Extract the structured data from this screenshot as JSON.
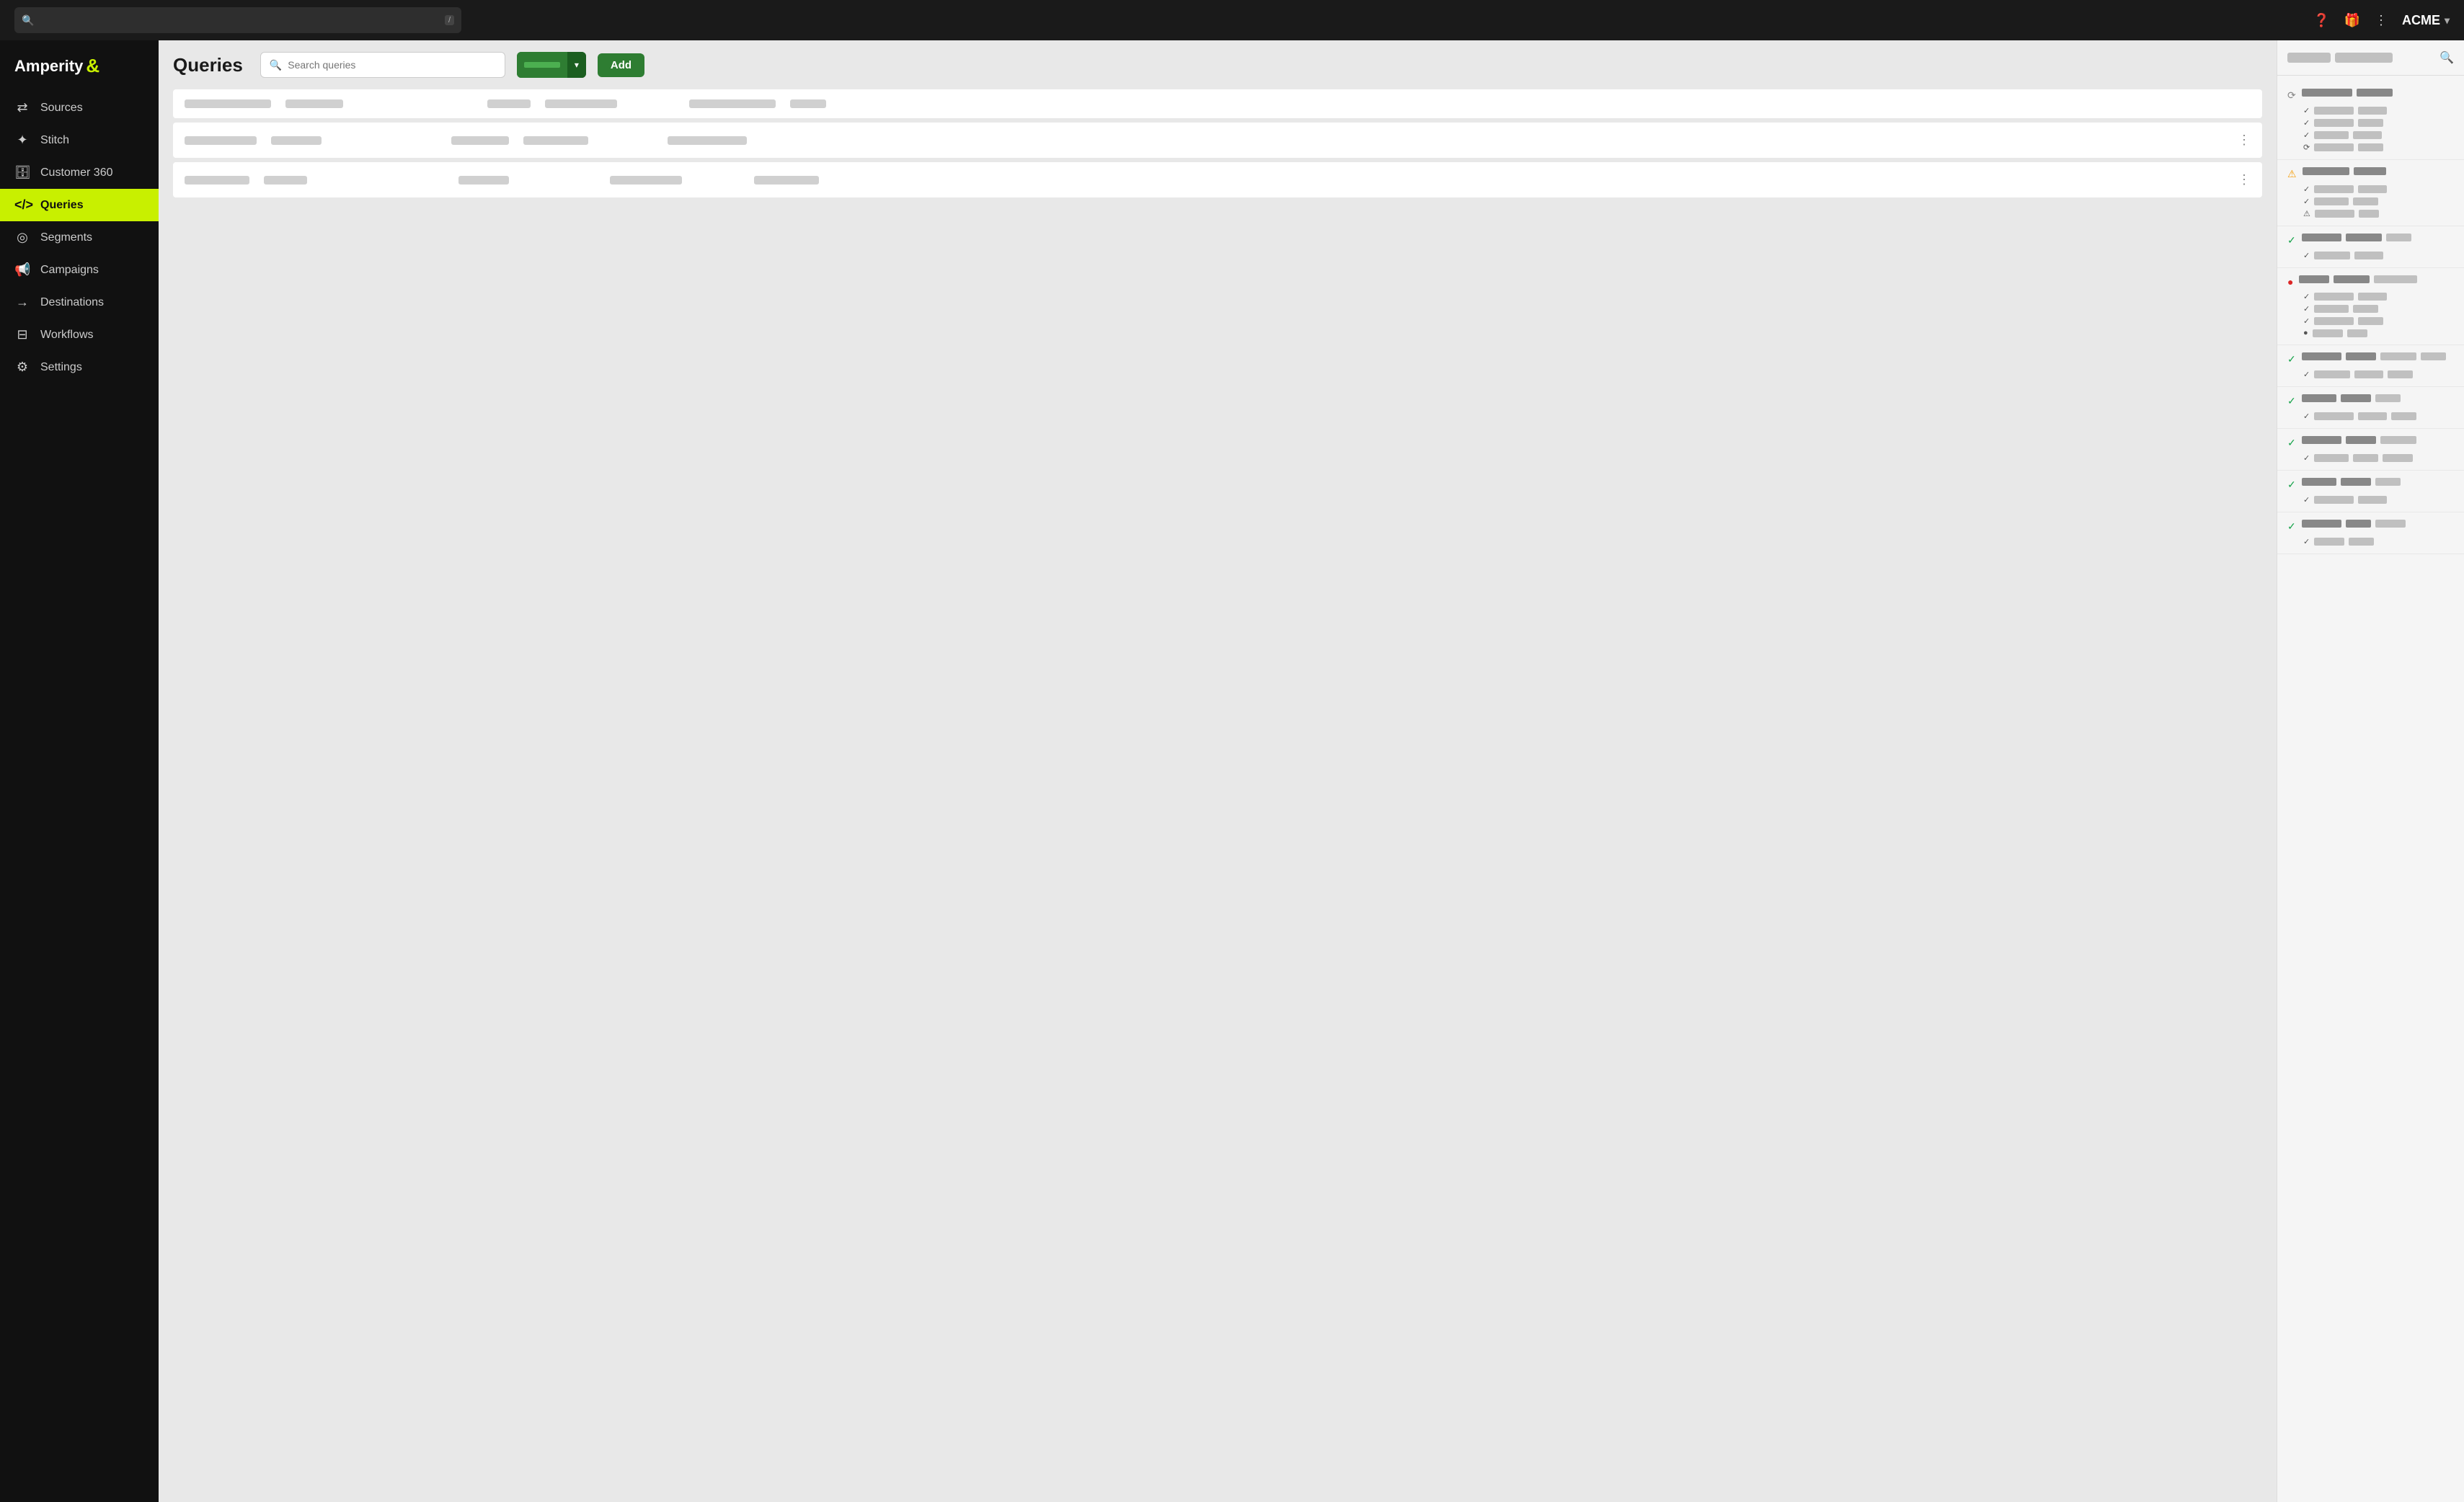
{
  "app": {
    "name": "Amperity",
    "account": "ACME"
  },
  "topbar": {
    "search_placeholder": "/",
    "help_icon": "?",
    "gift_icon": "🎁",
    "more_icon": "⋮",
    "chevron": "▾"
  },
  "sidebar": {
    "items": [
      {
        "id": "sources",
        "label": "Sources",
        "icon": "⇄",
        "active": false
      },
      {
        "id": "stitch",
        "label": "Stitch",
        "icon": "✦",
        "active": false
      },
      {
        "id": "customer360",
        "label": "Customer 360",
        "icon": "🗄",
        "active": false
      },
      {
        "id": "queries",
        "label": "Queries",
        "icon": "</>",
        "active": true
      },
      {
        "id": "segments",
        "label": "Segments",
        "icon": "◎",
        "active": false
      },
      {
        "id": "campaigns",
        "label": "Campaigns",
        "icon": "📢",
        "active": false
      },
      {
        "id": "destinations",
        "label": "Destinations",
        "icon": "→",
        "active": false
      },
      {
        "id": "workflows",
        "label": "Workflows",
        "icon": "⊟",
        "active": false
      },
      {
        "id": "settings",
        "label": "Settings",
        "icon": "⚙",
        "active": false
      }
    ]
  },
  "queries": {
    "title": "Queries",
    "search_placeholder": "Search queries",
    "add_label": "Add",
    "table_rows": [
      {
        "id": 1
      },
      {
        "id": 2
      },
      {
        "id": 3
      }
    ]
  },
  "right_panel": {
    "header_label1": "████████",
    "header_label2": "██████████",
    "items": [
      {
        "id": 1,
        "status": "loading",
        "title_parts": [
          18,
          12
        ],
        "rows": [
          {
            "icon": "check",
            "parts": [
              14,
              10
            ]
          },
          {
            "icon": "check",
            "parts": [
              14,
              8
            ]
          },
          {
            "icon": "check",
            "parts": [
              12,
              10
            ]
          },
          {
            "icon": "loading",
            "parts": [
              14,
              8
            ]
          }
        ]
      },
      {
        "id": 2,
        "status": "warning",
        "title_parts": [
          16,
          10
        ],
        "rows": [
          {
            "icon": "check",
            "parts": [
              14,
              10
            ]
          },
          {
            "icon": "check",
            "parts": [
              12,
              8
            ]
          },
          {
            "icon": "warning",
            "parts": [
              14,
              6
            ]
          }
        ]
      },
      {
        "id": 3,
        "status": "success",
        "title_parts": [
          14,
          12,
          8
        ],
        "rows": [
          {
            "icon": "check",
            "parts": [
              12,
              10
            ]
          }
        ]
      },
      {
        "id": 4,
        "status": "error",
        "title_parts": [
          10,
          12,
          14
        ],
        "rows": [
          {
            "icon": "check",
            "parts": [
              14,
              10
            ]
          },
          {
            "icon": "check",
            "parts": [
              12,
              8
            ]
          },
          {
            "icon": "check",
            "parts": [
              14,
              8
            ]
          },
          {
            "icon": "error",
            "parts": [
              10,
              6
            ]
          }
        ]
      },
      {
        "id": 5,
        "status": "success",
        "title_parts": [
          14,
          10,
          12,
          8
        ],
        "rows": [
          {
            "icon": "check",
            "parts": [
              12,
              10,
              8
            ]
          }
        ]
      },
      {
        "id": 6,
        "status": "success",
        "title_parts": [
          12,
          10,
          8
        ],
        "rows": [
          {
            "icon": "check",
            "parts": [
              14,
              10,
              8
            ]
          }
        ]
      },
      {
        "id": 7,
        "status": "success",
        "title_parts": [
          14,
          10,
          12
        ],
        "rows": [
          {
            "icon": "check",
            "parts": [
              12,
              8,
              10
            ]
          }
        ]
      },
      {
        "id": 8,
        "status": "success",
        "title_parts": [
          12,
          10,
          8
        ],
        "rows": [
          {
            "icon": "check",
            "parts": [
              14,
              10
            ]
          }
        ]
      },
      {
        "id": 9,
        "status": "success",
        "title_parts": [
          14,
          8,
          10
        ],
        "rows": [
          {
            "icon": "check",
            "parts": [
              10,
              8
            ]
          }
        ]
      }
    ]
  }
}
